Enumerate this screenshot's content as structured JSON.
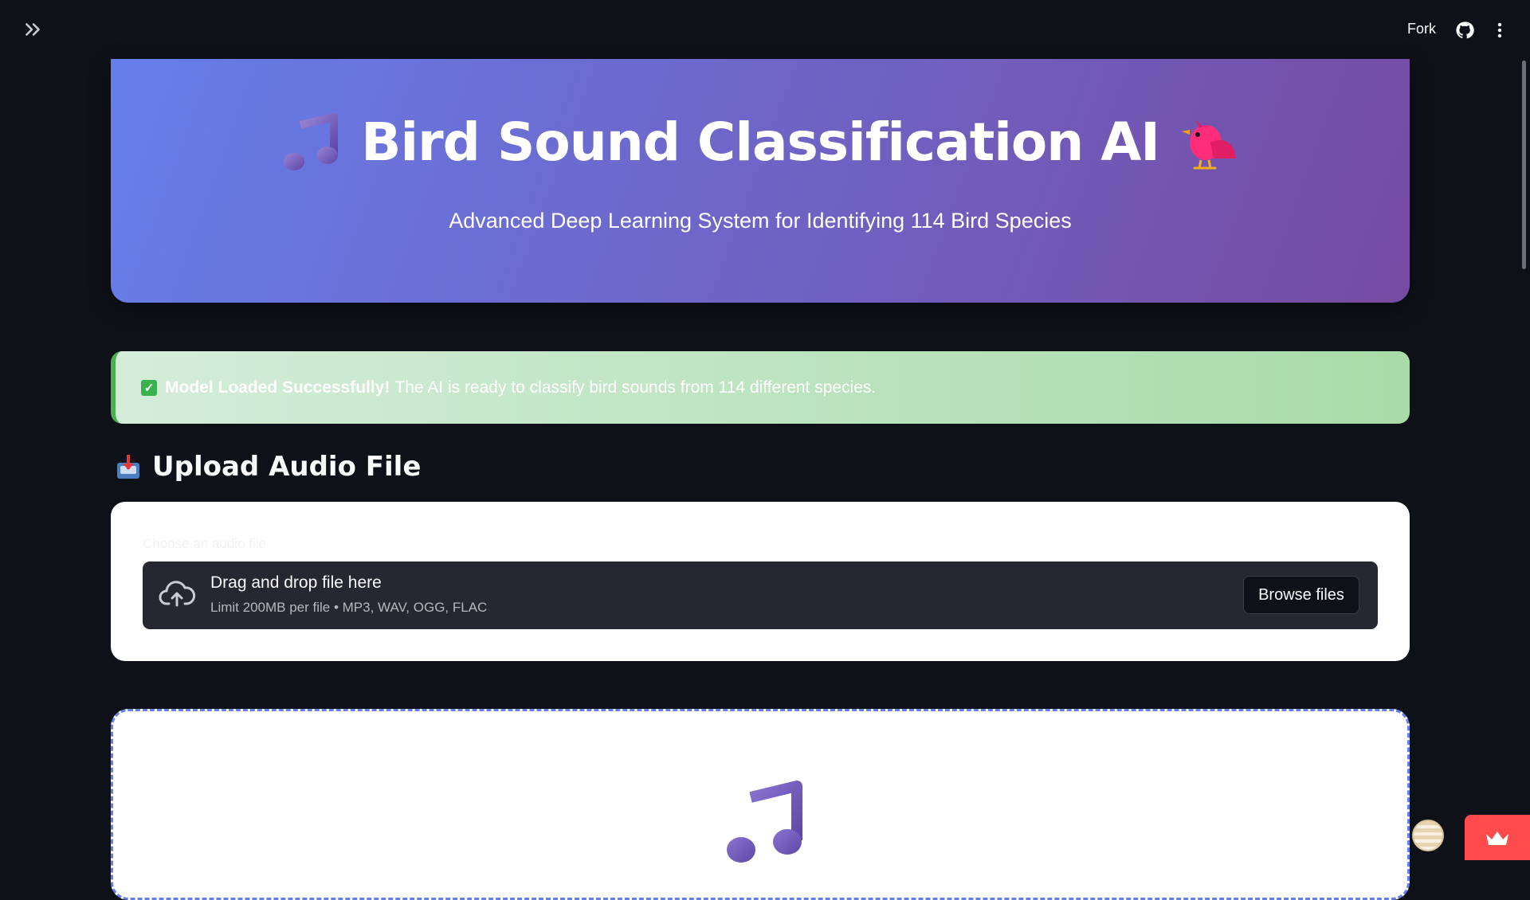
{
  "topbar": {
    "fork_label": "Fork"
  },
  "hero": {
    "title": "Bird Sound Classification AI",
    "subtitle": "Advanced Deep Learning System for Identifying 114 Bird Species",
    "left_icon": "musical-notes-icon",
    "right_icon": "bird-icon"
  },
  "status": {
    "bold": "Model Loaded Successfully!",
    "message": "The AI is ready to classify bird sounds from 114 different species."
  },
  "upload": {
    "heading": "Upload Audio File",
    "label": "Choose an audio file",
    "drop_title": "Drag and drop file here",
    "drop_sub": "Limit 200MB per file • MP3, WAV, OGG, FLAC",
    "browse_label": "Browse files"
  },
  "colors": {
    "background": "#0e1117",
    "hero_gradient_start": "#667eea",
    "hero_gradient_end": "#764ba2",
    "success_border": "#4caf50",
    "accent_red": "#ff4b4b"
  }
}
